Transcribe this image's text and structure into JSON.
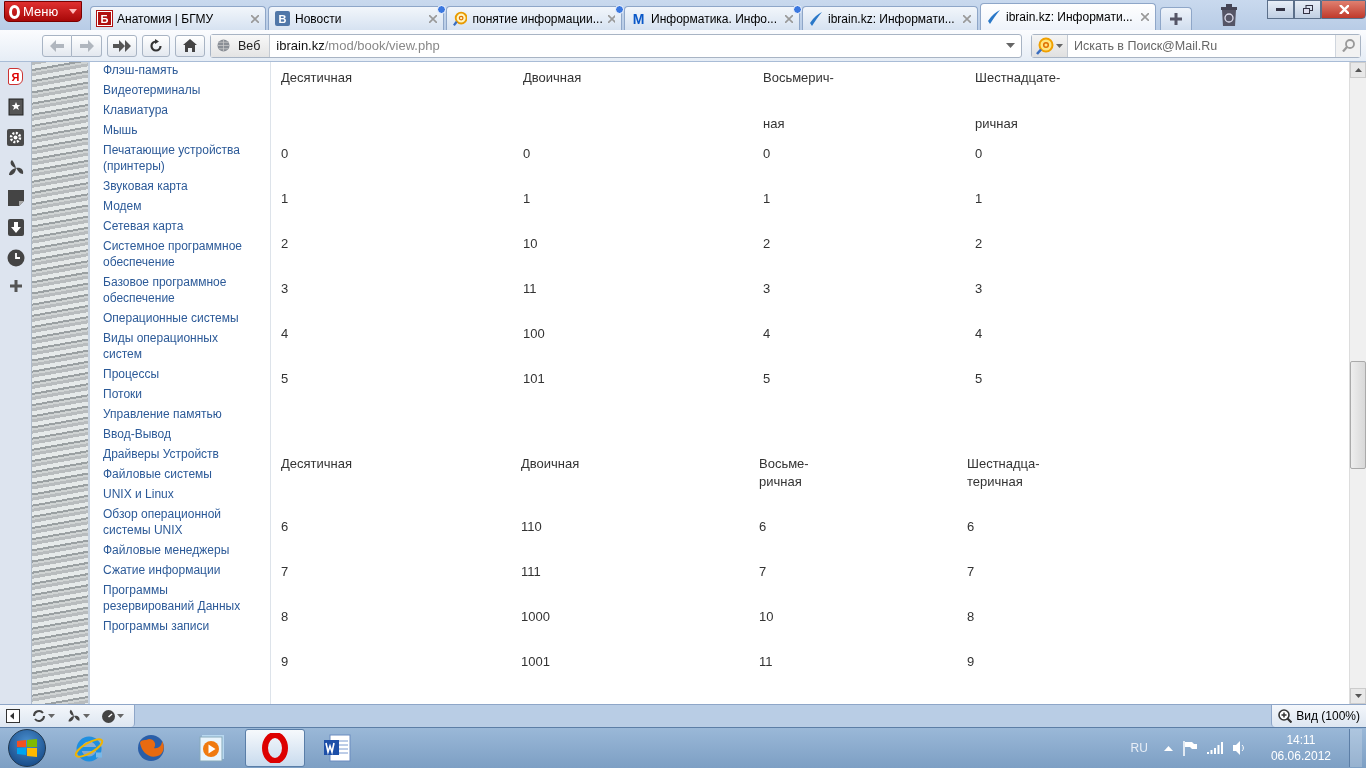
{
  "browser": {
    "menu_label": "Меню"
  },
  "tabs": [
    {
      "label": "Анатомия | БГМУ",
      "kind": "letter",
      "icon_text": "Б",
      "updated": false,
      "selected": false
    },
    {
      "label": "Новости",
      "kind": "letter",
      "icon_text": "В",
      "updated": true,
      "selected": false
    },
    {
      "label": "понятие информации...",
      "kind": "mail",
      "updated": true,
      "selected": false
    },
    {
      "label": "Информатика. Инфо...",
      "kind": "letter",
      "icon_text": "M",
      "updated": true,
      "selected": false
    },
    {
      "label": "ibrain.kz: Информати...",
      "kind": "swoosh",
      "updated": false,
      "selected": false
    },
    {
      "label": "ibrain.kz: Информати...",
      "kind": "swoosh",
      "updated": false,
      "selected": true
    }
  ],
  "address": {
    "mode_label": "Веб",
    "domain": "ibrain.kz",
    "path": "/mod/book/view.php"
  },
  "search": {
    "placeholder": "Искать в Поиск@Mail.Ru"
  },
  "panel": {
    "badge_text": "Я"
  },
  "sidebar": {
    "items": [
      "Флэш-память",
      "Видеотерминалы",
      "Клавиатура",
      "Мышь",
      "Печатающие устройства (принтеры)",
      "Звуковая карта",
      "Модем",
      "Сетевая карта",
      "Системное программное обеспечение",
      "Базовое программное обеспечение",
      "Операционные системы",
      "Виды операционных систем",
      "Процессы",
      "Потоки",
      "Управление памятью",
      "Ввод-Вывод",
      "Драйверы Устройств",
      "Файловые системы",
      "UNIX и Linux",
      "Обзор операционной системы UNIX",
      "Файловые менеджеры",
      "Сжатие информации",
      "Программы резервирований Данных",
      "Программы записи"
    ]
  },
  "tables": [
    {
      "headers": [
        [
          "Десятичная"
        ],
        [
          "Двоичная"
        ],
        [
          "Восьмерич-",
          "ная"
        ],
        [
          "Шестнадцате-",
          "ричная"
        ]
      ],
      "rows": [
        [
          "0",
          "0",
          "0",
          "0"
        ],
        [
          "1",
          "1",
          "1",
          "1"
        ],
        [
          "2",
          "10",
          "2",
          "2"
        ],
        [
          "3",
          "11",
          "3",
          "3"
        ],
        [
          "4",
          "100",
          "4",
          "4"
        ],
        [
          "5",
          "101",
          "5",
          "5"
        ]
      ]
    },
    {
      "headers": [
        [
          "Десятичная"
        ],
        [
          "Двоичная"
        ],
        [
          "Восьме-",
          "ричная"
        ],
        [
          "Шестнадца-",
          "теричная"
        ]
      ],
      "rows": [
        [
          "6",
          "110",
          "6",
          "6"
        ],
        [
          "7",
          "111",
          "7",
          "7"
        ],
        [
          "8",
          "1000",
          "10",
          "8"
        ],
        [
          "9",
          "1001",
          "11",
          "9"
        ]
      ]
    }
  ],
  "status_bar": {
    "zoom_label": "Вид (100%)"
  },
  "taskbar": {
    "apps": [
      {
        "kind": "ie",
        "selected": false
      },
      {
        "kind": "firefox",
        "selected": false
      },
      {
        "kind": "media",
        "selected": false
      },
      {
        "kind": "opera",
        "selected": true
      },
      {
        "kind": "word",
        "selected": false
      }
    ]
  },
  "tray": {
    "language": "RU",
    "time": "14:11",
    "date": "06.06.2012"
  }
}
